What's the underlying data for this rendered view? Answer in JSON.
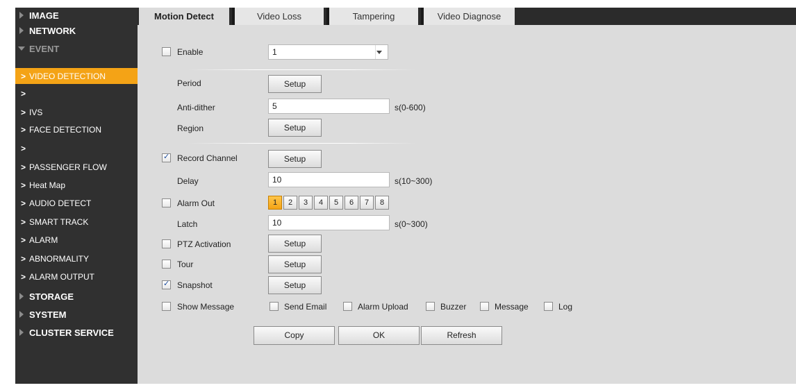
{
  "sidebar": {
    "top": [
      {
        "label": "IMAGE"
      },
      {
        "label": "NETWORK"
      },
      {
        "label": "EVENT"
      },
      {
        "label": "STORAGE"
      },
      {
        "label": "SYSTEM"
      },
      {
        "label": "CLUSTER SERVICE"
      }
    ],
    "event_items": [
      {
        "label": "VIDEO DETECTION"
      },
      {
        "label": ""
      },
      {
        "label": "IVS"
      },
      {
        "label": "FACE DETECTION"
      },
      {
        "label": ""
      },
      {
        "label": "PASSENGER FLOW"
      },
      {
        "label": "Heat Map"
      },
      {
        "label": "AUDIO DETECT"
      },
      {
        "label": "SMART TRACK"
      },
      {
        "label": "ALARM"
      },
      {
        "label": "ABNORMALITY"
      },
      {
        "label": "ALARM OUTPUT"
      }
    ]
  },
  "tabs": [
    {
      "label": "Motion Detect"
    },
    {
      "label": "Video Loss"
    },
    {
      "label": "Tampering"
    },
    {
      "label": "Video Diagnose"
    }
  ],
  "form": {
    "enable": {
      "label": "Enable",
      "checked": false,
      "value": "1"
    },
    "period": {
      "label": "Period",
      "button": "Setup"
    },
    "anti_dither": {
      "label": "Anti-dither",
      "value": "5",
      "unit": "s(0-600)"
    },
    "region": {
      "label": "Region",
      "button": "Setup"
    },
    "record_channel": {
      "label": "Record Channel",
      "checked": true,
      "button": "Setup"
    },
    "delay": {
      "label": "Delay",
      "value": "10",
      "unit": "s(10~300)"
    },
    "alarm_out": {
      "label": "Alarm Out",
      "checked": false,
      "channels": [
        "1",
        "2",
        "3",
        "4",
        "5",
        "6",
        "7",
        "8"
      ],
      "selected": "1"
    },
    "latch": {
      "label": "Latch",
      "value": "10",
      "unit": "s(0~300)"
    },
    "ptz": {
      "label": "PTZ Activation",
      "checked": false,
      "button": "Setup"
    },
    "tour": {
      "label": "Tour",
      "checked": false,
      "button": "Setup"
    },
    "snapshot": {
      "label": "Snapshot",
      "checked": true,
      "button": "Setup"
    },
    "show_message": {
      "label": "Show Message",
      "checked": false
    },
    "send_email": {
      "label": "Send Email",
      "checked": false
    },
    "alarm_upload": {
      "label": "Alarm Upload",
      "checked": false
    },
    "buzzer": {
      "label": "Buzzer",
      "checked": false
    },
    "message": {
      "label": "Message",
      "checked": false
    },
    "log": {
      "label": "Log",
      "checked": false
    }
  },
  "actions": {
    "copy": "Copy",
    "ok": "OK",
    "refresh": "Refresh"
  },
  "colors": {
    "sidebar": "#303030",
    "active": "#f4a316",
    "content": "#dcdcdc"
  }
}
